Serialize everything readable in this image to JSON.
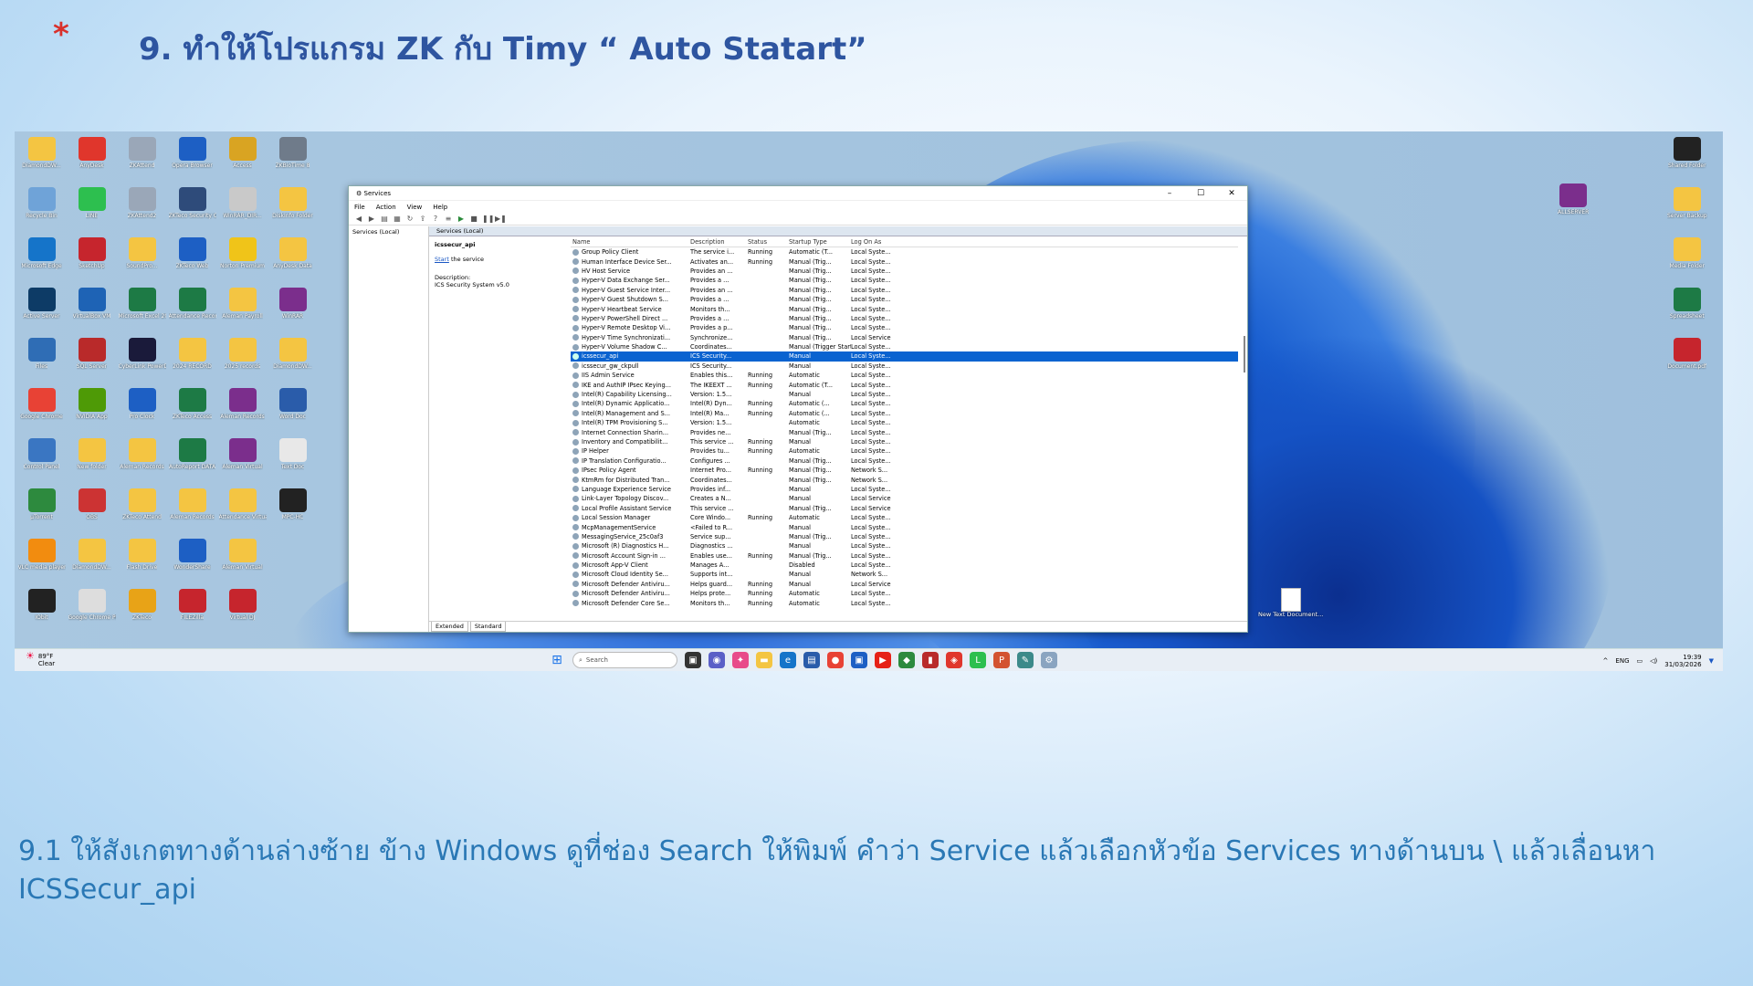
{
  "slide": {
    "bullet": "*",
    "title": "9. ทำให้โปรแกรม ZK กับ Timy “ Auto Statart”",
    "footer_line1": "9.1 ให้สังเกตทางด้านล่างซ้าย ข้าง Windows ดูที่ช่อง Search ให้พิมพ์ คำว่า Service  แล้วเลือกหัวข้อ Services ทางด้านบน \\ แล้วเลื่อนหา",
    "footer_line2": "ICSSecur_api"
  },
  "desktop_left_icons": [
    {
      "label": "DiamondDW...",
      "color": "#f4c542"
    },
    {
      "label": "AnyDesk",
      "color": "#e0362c"
    },
    {
      "label": "ZKAttend",
      "color": "#9aa7b8"
    },
    {
      "label": "Opera Browser",
      "color": "#1d5fc4"
    },
    {
      "label": "Access",
      "color": "#d9a422"
    },
    {
      "label": "ZKBioTime 8",
      "color": "#6f7b8a"
    },
    {
      "label": "Recycle Bin",
      "color": "#6fa3d8"
    },
    {
      "label": "LINE",
      "color": "#2dbf4f"
    },
    {
      "label": "ZKAttend2",
      "color": "#9aa7b8"
    },
    {
      "label": "ZKTeco Security Center",
      "color": "#2e4b7a"
    },
    {
      "label": "WinRAR_DIR...",
      "color": "#c9c9c9"
    },
    {
      "label": "DiskInfo Folder",
      "color": "#f4c542"
    },
    {
      "label": "Microsoft Edge",
      "color": "#1574c9"
    },
    {
      "label": "SketchUp",
      "color": "#c6252d"
    },
    {
      "label": "SoundPro...",
      "color": "#f4c542"
    },
    {
      "label": "ZKTeco Web",
      "color": "#1d5fc4"
    },
    {
      "label": "Norton Premium",
      "color": "#f0c419"
    },
    {
      "label": "AnyDesk Data",
      "color": "#f4c542"
    },
    {
      "label": "Active Server",
      "color": "#0d3b66"
    },
    {
      "label": "VirtualBox VM",
      "color": "#1e63b5"
    },
    {
      "label": "Microsoft Excel 2019",
      "color": "#1d7a45"
    },
    {
      "label": "Attendance Records",
      "color": "#1d7a45"
    },
    {
      "label": "Aleman Payroll",
      "color": "#f4c542"
    },
    {
      "label": "WinRAR",
      "color": "#7b2e8c"
    },
    {
      "label": "Files",
      "color": "#2f6db5"
    },
    {
      "label": "SQL Server",
      "color": "#b92a2a"
    },
    {
      "label": "CyberLink PowerDVD",
      "color": "#1a1a3a"
    },
    {
      "label": "2024 RECORD",
      "color": "#f4c542"
    },
    {
      "label": "2025 records",
      "color": "#f4c542"
    },
    {
      "label": "DiamondDW...",
      "color": "#f4c542"
    },
    {
      "label": "Google Chrome",
      "color": "#e84235"
    },
    {
      "label": "NVIDIA App",
      "color": "#4e9a06"
    },
    {
      "label": "Pro Clock",
      "color": "#1d5fc4"
    },
    {
      "label": "ZKTeco Access",
      "color": "#1d7a45"
    },
    {
      "label": "Aleman Records",
      "color": "#7b2e8c"
    },
    {
      "label": "Word Doc",
      "color": "#2a5caa"
    },
    {
      "label": "Control Panel",
      "color": "#3a76c2"
    },
    {
      "label": "New folder",
      "color": "#f4c542"
    },
    {
      "label": "Aleman Records",
      "color": "#f4c542"
    },
    {
      "label": "AutoReport DATA",
      "color": "#1d7a45"
    },
    {
      "label": "Aleman Virtual",
      "color": "#7b2e8c"
    },
    {
      "label": "Text Doc",
      "color": "#e8e8e8"
    },
    {
      "label": "µTorrent",
      "color": "#2d8a3e"
    },
    {
      "label": "OBS",
      "color": "#c33"
    },
    {
      "label": "ZKTeco Attend",
      "color": "#f4c542"
    },
    {
      "label": "Aleman Records",
      "color": "#f4c542"
    },
    {
      "label": "Attendance Virtual",
      "color": "#f4c542"
    },
    {
      "label": "MPC-HC",
      "color": "#222"
    },
    {
      "label": "VLC media player",
      "color": "#f28c0f"
    },
    {
      "label": "DiamondDW...",
      "color": "#f4c542"
    },
    {
      "label": "Flash Drive",
      "color": "#f4c542"
    },
    {
      "label": "WonderShare",
      "color": "#1d5fc4"
    },
    {
      "label": "Aleman Virtual",
      "color": "#f4c542"
    },
    {
      "label": "",
      "color": "transparent"
    },
    {
      "label": "IObit",
      "color": "#222"
    },
    {
      "label": "Google Chrome PDF",
      "color": "#ddd"
    },
    {
      "label": "ZKTeco",
      "color": "#e8a317"
    },
    {
      "label": "FILEZilla",
      "color": "#c6252d"
    },
    {
      "label": "Virtual DJ",
      "color": "#c6252d"
    },
    {
      "label": "",
      "color": "transparent"
    }
  ],
  "desktop_right_icons": [
    {
      "label": "Shared Folder",
      "color": "#222"
    },
    {
      "label": "Server Backup",
      "color": "#f4c542"
    },
    {
      "label": "Media Folder",
      "color": "#f4c542"
    },
    {
      "label": "Spreadsheet",
      "color": "#1d7a45"
    },
    {
      "label": "Document.pdf",
      "color": "#c6252d"
    }
  ],
  "desktop_right2_icon": {
    "label": "ALLSERVER",
    "color": "#7b2e8c"
  },
  "new_text_doc": "New Text Document...",
  "services_window": {
    "title": "Services",
    "menu": [
      "File",
      "Action",
      "View",
      "Help"
    ],
    "tree_item": "Services (Local)",
    "header": "Services (Local)",
    "selected_name": "icssecur_api",
    "start_link": "Start",
    "start_text": " the service",
    "desc_label": "Description:",
    "desc_text": "ICS Security System v5.0",
    "columns": [
      "Name",
      "Description",
      "Status",
      "Startup Type",
      "Log On As"
    ],
    "tabs": [
      "Extended",
      "Standard"
    ],
    "rows": [
      [
        "Group Policy Client",
        "The service i...",
        "Running",
        "Automatic (T...",
        "Local Syste..."
      ],
      [
        "Human Interface Device Ser...",
        "Activates an...",
        "Running",
        "Manual (Trig...",
        "Local Syste..."
      ],
      [
        "HV Host Service",
        "Provides an ...",
        "",
        "Manual (Trig...",
        "Local Syste..."
      ],
      [
        "Hyper-V Data Exchange Ser...",
        "Provides a ...",
        "",
        "Manual (Trig...",
        "Local Syste..."
      ],
      [
        "Hyper-V Guest Service Inter...",
        "Provides an ...",
        "",
        "Manual (Trig...",
        "Local Syste..."
      ],
      [
        "Hyper-V Guest Shutdown S...",
        "Provides a ...",
        "",
        "Manual (Trig...",
        "Local Syste..."
      ],
      [
        "Hyper-V Heartbeat Service",
        "Monitors th...",
        "",
        "Manual (Trig...",
        "Local Syste..."
      ],
      [
        "Hyper-V PowerShell Direct ...",
        "Provides a ...",
        "",
        "Manual (Trig...",
        "Local Syste..."
      ],
      [
        "Hyper-V Remote Desktop Vi...",
        "Provides a p...",
        "",
        "Manual (Trig...",
        "Local Syste..."
      ],
      [
        "Hyper-V Time Synchronizati...",
        "Synchronize...",
        "",
        "Manual (Trig...",
        "Local Service"
      ],
      [
        "Hyper-V Volume Shadow C...",
        "Coordinates...",
        "",
        "Manual (Trigger Start)",
        "Local Syste..."
      ],
      [
        "icssecur_api",
        "ICS Security...",
        "",
        "Manual",
        "Local Syste..."
      ],
      [
        "icssecur_gw_ckpull",
        "ICS Security...",
        "",
        "Manual",
        "Local Syste..."
      ],
      [
        "IIS Admin Service",
        "Enables this...",
        "Running",
        "Automatic",
        "Local Syste..."
      ],
      [
        "IKE and AuthIP IPsec Keying...",
        "The IKEEXT ...",
        "Running",
        "Automatic (T...",
        "Local Syste..."
      ],
      [
        "Intel(R) Capability Licensing...",
        "Version: 1.5...",
        "",
        "Manual",
        "Local Syste..."
      ],
      [
        "Intel(R) Dynamic Applicatio...",
        "Intel(R) Dyn...",
        "Running",
        "Automatic (...",
        "Local Syste..."
      ],
      [
        "Intel(R) Management and S...",
        "Intel(R) Ma...",
        "Running",
        "Automatic (...",
        "Local Syste..."
      ],
      [
        "Intel(R) TPM Provisioning S...",
        "Version: 1.5...",
        "",
        "Automatic",
        "Local Syste..."
      ],
      [
        "Internet Connection Sharin...",
        "Provides ne...",
        "",
        "Manual (Trig...",
        "Local Syste..."
      ],
      [
        "Inventory and Compatibilit...",
        "This service ...",
        "Running",
        "Manual",
        "Local Syste..."
      ],
      [
        "IP Helper",
        "Provides tu...",
        "Running",
        "Automatic",
        "Local Syste..."
      ],
      [
        "IP Translation Configuratio...",
        "Configures ...",
        "",
        "Manual (Trig...",
        "Local Syste..."
      ],
      [
        "IPsec Policy Agent",
        "Internet Pro...",
        "Running",
        "Manual (Trig...",
        "Network S..."
      ],
      [
        "KtmRm for Distributed Tran...",
        "Coordinates...",
        "",
        "Manual (Trig...",
        "Network S..."
      ],
      [
        "Language Experience Service",
        "Provides inf...",
        "",
        "Manual",
        "Local Syste..."
      ],
      [
        "Link-Layer Topology Discov...",
        "Creates a N...",
        "",
        "Manual",
        "Local Service"
      ],
      [
        "Local Profile Assistant Service",
        "This service ...",
        "",
        "Manual (Trig...",
        "Local Service"
      ],
      [
        "Local Session Manager",
        "Core Windo...",
        "Running",
        "Automatic",
        "Local Syste..."
      ],
      [
        "McpManagementService",
        "<Failed to R...",
        "",
        "Manual",
        "Local Syste..."
      ],
      [
        "MessagingService_25c0af3",
        "Service sup...",
        "",
        "Manual (Trig...",
        "Local Syste..."
      ],
      [
        "Microsoft (R) Diagnostics H...",
        "Diagnostics ...",
        "",
        "Manual",
        "Local Syste..."
      ],
      [
        "Microsoft Account Sign-in ...",
        "Enables use...",
        "Running",
        "Manual (Trig...",
        "Local Syste..."
      ],
      [
        "Microsoft App-V Client",
        "Manages A...",
        "",
        "Disabled",
        "Local Syste..."
      ],
      [
        "Microsoft Cloud Identity Se...",
        "Supports int...",
        "",
        "Manual",
        "Network S..."
      ],
      [
        "Microsoft Defender Antiviru...",
        "Helps guard...",
        "Running",
        "Manual",
        "Local Service"
      ],
      [
        "Microsoft Defender Antiviru...",
        "Helps prote...",
        "Running",
        "Automatic",
        "Local Syste..."
      ],
      [
        "Microsoft Defender Core Se...",
        "Monitors th...",
        "Running",
        "Automatic",
        "Local Syste..."
      ]
    ],
    "selected_index": 11
  },
  "taskbar": {
    "temp": "89°F",
    "weather": "Clear",
    "search_placeholder": "Search",
    "lang": "ENG",
    "time": "19:39",
    "date": "31/03/2026"
  }
}
